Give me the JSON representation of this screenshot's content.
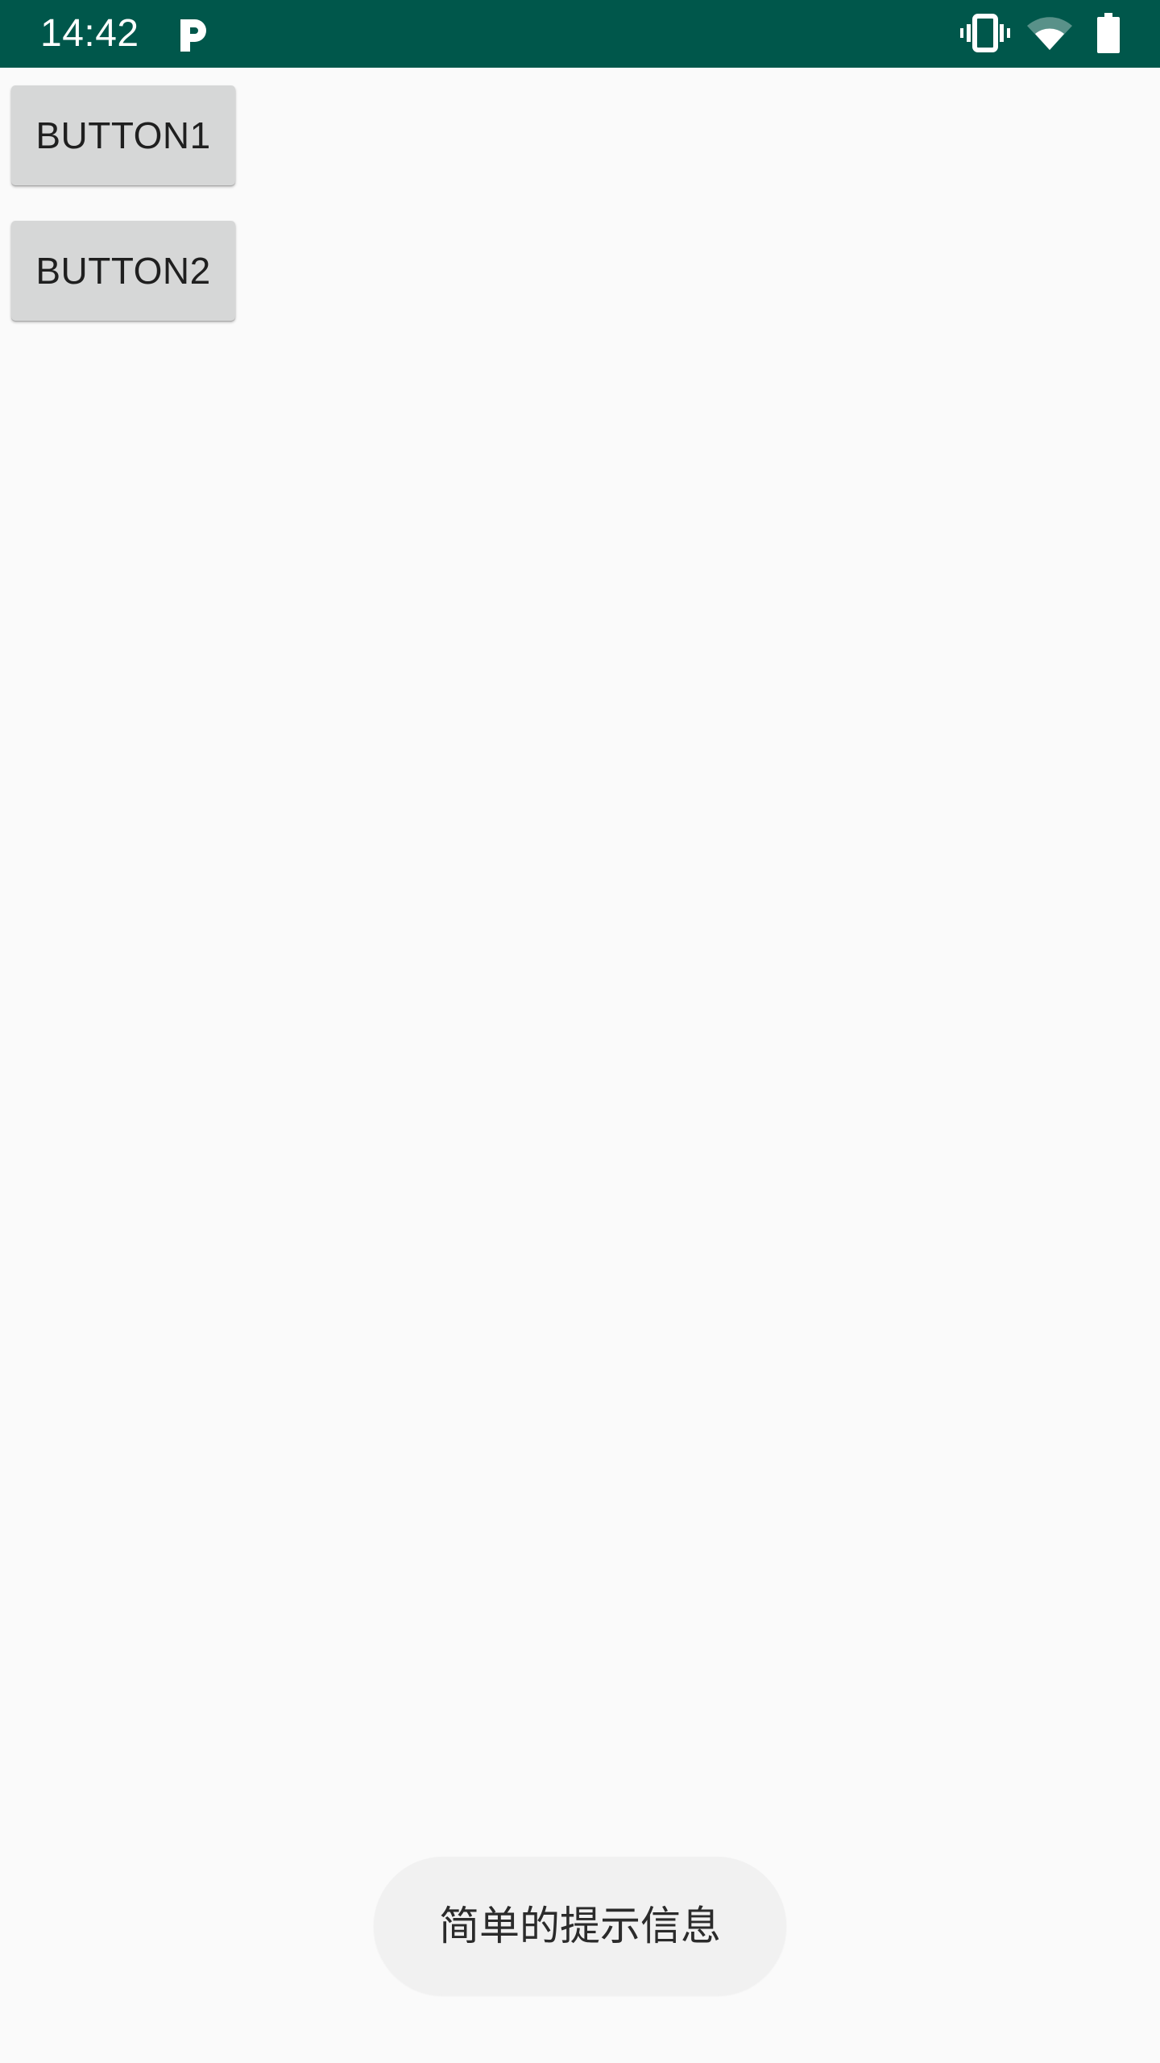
{
  "status_bar": {
    "time": "14:42",
    "background_color": "#00574b",
    "icons": [
      "parking-app-icon",
      "vibrate-icon",
      "wifi-icon",
      "battery-icon"
    ]
  },
  "buttons": {
    "button1_label": "BUTTON1",
    "button2_label": "BUTTON2"
  },
  "toast": {
    "message": "简单的提示信息"
  }
}
